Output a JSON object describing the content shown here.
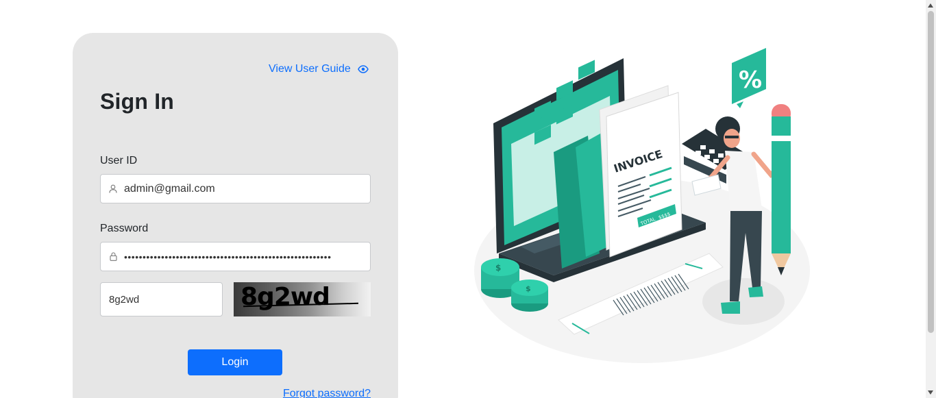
{
  "card": {
    "guide_link": "View User Guide",
    "title": "Sign In",
    "user_id": {
      "label": "User ID",
      "value": "admin@gmail.com"
    },
    "password": {
      "label": "Password",
      "value": "••••••••••••••••••••••••••••••••••••••••••••••••••••••••"
    },
    "captcha": {
      "input_value": "8g2wd",
      "image_text": "8g2wd"
    },
    "login_label": "Login",
    "forgot_label": "Forgot password?"
  },
  "illustration": {
    "invoice_text": "INVOICE",
    "total_text": "TOTAL",
    "amount_text": "$$$$",
    "percent_text": "%"
  },
  "colors": {
    "accent": "#0d6efd",
    "card_bg": "#e6e6e6",
    "teal": "#26b99a",
    "dark_slate": "#263238"
  },
  "icons": [
    "eye-icon",
    "user-icon",
    "lock-icon"
  ]
}
